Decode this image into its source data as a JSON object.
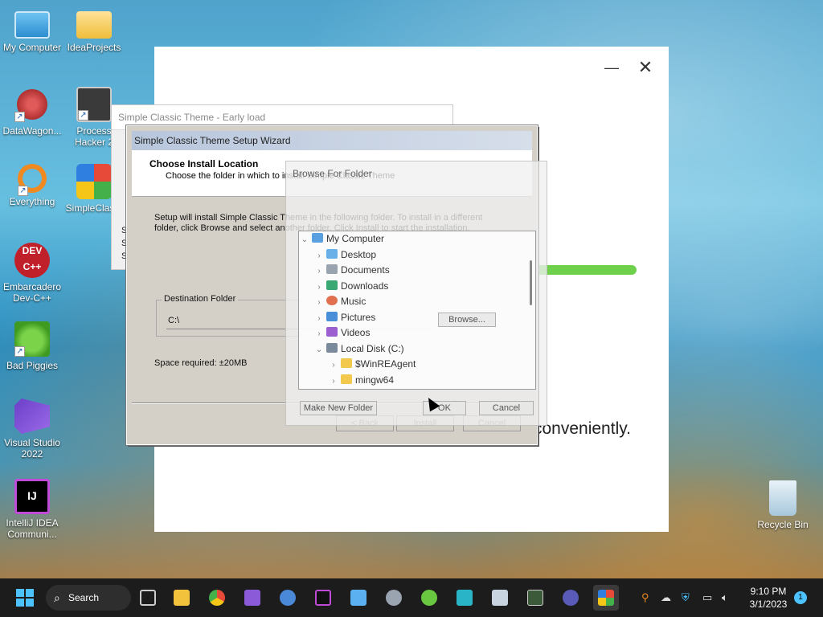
{
  "desktop": {
    "icons": [
      {
        "label": "My Computer"
      },
      {
        "label": "IdeaProjects"
      },
      {
        "label": "DataWagon..."
      },
      {
        "label": "Process Hacker 2"
      },
      {
        "label": "Everything"
      },
      {
        "label": "SimpleClas..."
      },
      {
        "label": "Embarcadero Dev-C++"
      },
      {
        "label": "Bad Piggies"
      },
      {
        "label": "Visual Studio 2022"
      },
      {
        "label": "IntelliJ IDEA Communi..."
      },
      {
        "label": "Recycle Bin"
      }
    ]
  },
  "big_window": {
    "tagline": "conveniently."
  },
  "early_window": {
    "title": "Simple Classic Theme - Early load",
    "side_text": "S\nS\nS"
  },
  "wizard": {
    "title": "Simple Classic Theme Setup Wizard",
    "header_title": "Choose Install Location",
    "header_sub": "Choose the folder in which to install Simple Classic Theme",
    "body_text": "Setup will install Simple Classic Theme in the following folder. To install in a different folder, click Browse and select another folder. Click Install to start the installation.",
    "dest_label": "Destination Folder",
    "dest_value": "C:\\",
    "browse_label": "Browse...",
    "space_required": "Space required: ±20MB",
    "back_label": "< Back",
    "install_label": "Install",
    "cancel_label": "Cancel"
  },
  "browse_dialog": {
    "title": "Browse For Folder",
    "faint_text": "install Simple Classic Theme",
    "tree": [
      {
        "label": "My Computer",
        "expanded": true,
        "color": "#5aa0e0"
      },
      {
        "label": "Desktop",
        "expanded": false,
        "color": "#6ab0e8"
      },
      {
        "label": "Documents",
        "expanded": false,
        "color": "#9aa4b0"
      },
      {
        "label": "Downloads",
        "expanded": false,
        "color": "#3aa872"
      },
      {
        "label": "Music",
        "expanded": false,
        "color": "#e07050"
      },
      {
        "label": "Pictures",
        "expanded": false,
        "color": "#4a90d8"
      },
      {
        "label": "Videos",
        "expanded": false,
        "color": "#9b5fd0"
      },
      {
        "label": "Local Disk (C:)",
        "expanded": true,
        "color": "#7a8a9a"
      },
      {
        "label": "$WinREAgent",
        "expanded": false,
        "color": "#f2c94c"
      },
      {
        "label": "mingw64",
        "expanded": false,
        "color": "#f2c94c"
      }
    ],
    "make_new_folder": "Make New Folder",
    "ok": "OK",
    "cancel": "Cancel"
  },
  "taskbar": {
    "search_label": "Search",
    "apps": [
      "file-explorer",
      "chrome",
      "visual-studio",
      "qbittorrent",
      "intellij",
      "notepad",
      "settings",
      "bad-piggies",
      "azure",
      "resource-monitor",
      "process-hacker",
      "cpu-z",
      "simple-classic-setup"
    ],
    "time": "9:10 PM",
    "date": "3/1/2023",
    "notifications": "1"
  }
}
